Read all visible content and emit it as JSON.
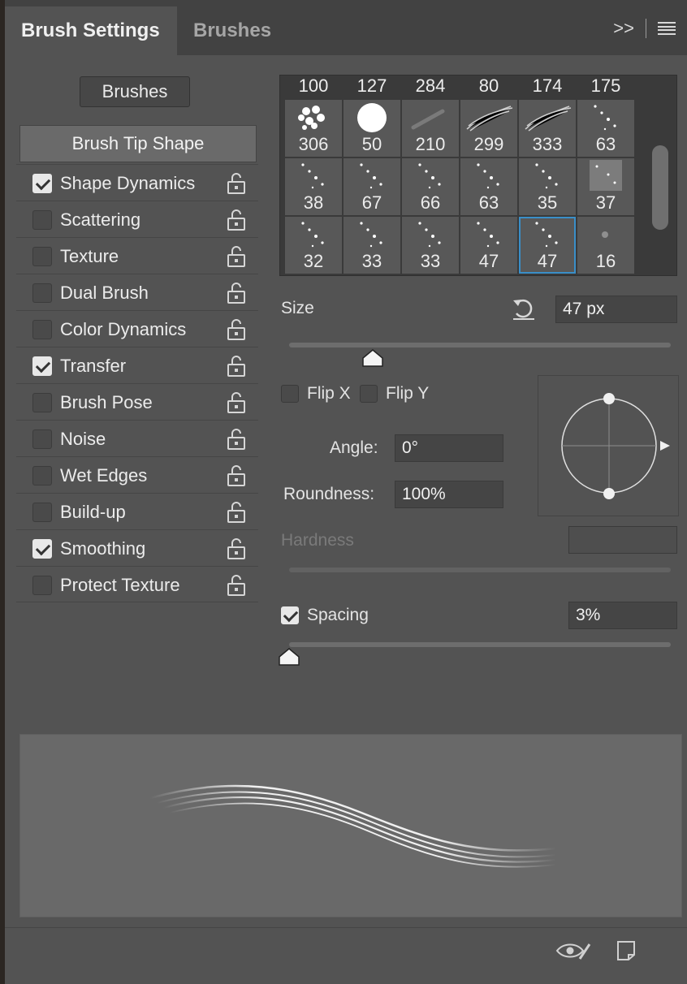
{
  "tabs": {
    "active": "Brush Settings",
    "inactive": "Brushes",
    "overflow": ">>"
  },
  "left": {
    "brushes_button": "Brushes",
    "tip_shape": "Brush Tip Shape",
    "options": [
      {
        "label": "Shape Dynamics",
        "checked": true
      },
      {
        "label": "Scattering",
        "checked": false
      },
      {
        "label": "Texture",
        "checked": false
      },
      {
        "label": "Dual Brush",
        "checked": false
      },
      {
        "label": "Color Dynamics",
        "checked": false
      },
      {
        "label": "Transfer",
        "checked": true
      },
      {
        "label": "Brush Pose",
        "checked": false
      },
      {
        "label": "Noise",
        "checked": false
      },
      {
        "label": "Wet Edges",
        "checked": false
      },
      {
        "label": "Build-up",
        "checked": false
      },
      {
        "label": "Smoothing",
        "checked": true
      },
      {
        "label": "Protect Texture",
        "checked": false
      }
    ]
  },
  "grid": {
    "top_row": [
      "100",
      "127",
      "284",
      "80",
      "174",
      "175"
    ],
    "rows": [
      [
        "306",
        "50",
        "210",
        "299",
        "333",
        "63"
      ],
      [
        "38",
        "67",
        "66",
        "63",
        "35",
        "37"
      ],
      [
        "32",
        "33",
        "33",
        "47",
        "47",
        "16"
      ]
    ],
    "selected": "47"
  },
  "size": {
    "label": "Size",
    "value": "47 px",
    "fraction": 0.22
  },
  "flip_x": {
    "label": "Flip X",
    "checked": false
  },
  "flip_y": {
    "label": "Flip Y",
    "checked": false
  },
  "angle": {
    "label": "Angle:",
    "value": "0°"
  },
  "roundness": {
    "label": "Roundness:",
    "value": "100%"
  },
  "hardness": {
    "label": "Hardness",
    "value": ""
  },
  "spacing": {
    "label": "Spacing",
    "checked": true,
    "value": "3%",
    "fraction": 0.0
  },
  "colors": {
    "panel": "#535353",
    "tabbar": "#424242",
    "selection": "#3a8fc8"
  }
}
